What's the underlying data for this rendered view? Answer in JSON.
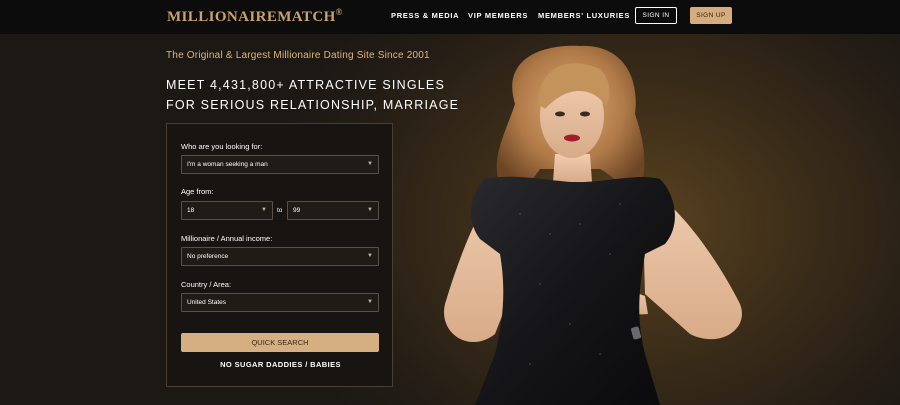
{
  "header": {
    "logo": "MILLIONAIREMATCH",
    "logo_mark": "®",
    "nav": [
      "PRESS & MEDIA",
      "VIP MEMBERS",
      "MEMBERS' LUXURIES"
    ],
    "signin_label": "SIGN IN",
    "signup_label": "SIGN UP"
  },
  "hero": {
    "tagline": "The Original & Largest Millionaire Dating Site Since 2001",
    "headline_line1": "MEET 4,431,800+ ATTRACTIVE SINGLES",
    "headline_line2": "FOR SERIOUS RELATIONSHIP, MARRIAGE"
  },
  "search_form": {
    "looking_for_label": "Who are you looking for:",
    "looking_for_value": "I'm a woman seeking a man",
    "age_label": "Age from:",
    "age_from": "18",
    "age_to_label": "to",
    "age_to": "99",
    "income_label": "Millionaire / Annual income:",
    "income_value": "No preference",
    "country_label": "Country / Area:",
    "country_value": "United States",
    "search_button": "QUICK SEARCH",
    "footer_note": "NO SUGAR DADDIES / BABIES"
  },
  "colors": {
    "accent": "#d6ac7c",
    "logo": "#c9a36b",
    "tagline": "#e3b57c",
    "panel_bg": "#171411"
  },
  "icons": {
    "dropdown": "chevron-down-icon"
  }
}
